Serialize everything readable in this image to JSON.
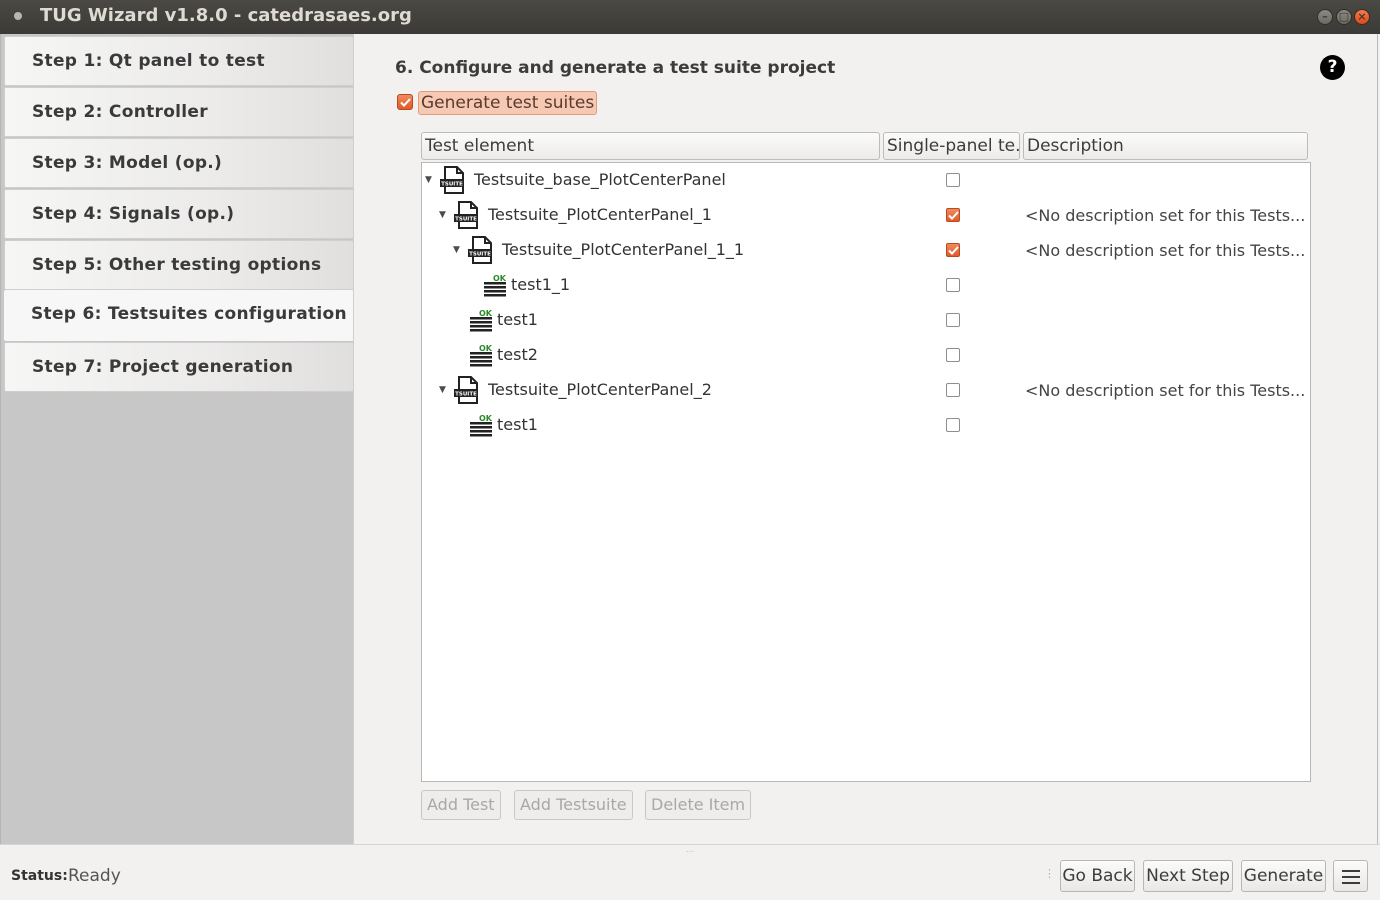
{
  "window": {
    "title": "TUG Wizard v1.8.0 - catedrasaes.org",
    "controls": {
      "minimize": "–",
      "maximize": "□",
      "close": "×"
    }
  },
  "sidebar": {
    "steps": [
      {
        "label": "Step 1: Qt panel to test"
      },
      {
        "label": "Step 2: Controller"
      },
      {
        "label": "Step 3: Model (op.)"
      },
      {
        "label": "Step 4: Signals (op.)"
      },
      {
        "label": "Step 5: Other testing options"
      },
      {
        "label": "Step 6: Testsuites configuration",
        "active": true
      },
      {
        "label": "Step 7: Project generation"
      }
    ]
  },
  "main": {
    "title": "6. Configure and generate a test suite project",
    "help": "?",
    "generate_checkbox": {
      "label": "Generate test suites",
      "checked": true
    },
    "tree": {
      "columns": [
        "Test element",
        "Single-panel te...",
        "Description"
      ],
      "rows": [
        {
          "type": "suite",
          "label": "Testsuite_base_PlotCenterPanel",
          "expanded": true,
          "checked": false,
          "description": ""
        },
        {
          "type": "suite",
          "label": "Testsuite_PlotCenterPanel_1",
          "expanded": true,
          "checked": true,
          "description": "<No description set for this Tests..."
        },
        {
          "type": "suite",
          "label": "Testsuite_PlotCenterPanel_1_1",
          "expanded": true,
          "checked": true,
          "description": "<No description set for this Tests..."
        },
        {
          "type": "test",
          "label": "test1_1",
          "checked": false,
          "description": ""
        },
        {
          "type": "test",
          "label": "test1",
          "checked": false,
          "description": ""
        },
        {
          "type": "test",
          "label": "test2",
          "checked": false,
          "description": ""
        },
        {
          "type": "suite",
          "label": "Testsuite_PlotCenterPanel_2",
          "expanded": true,
          "checked": false,
          "description": "<No description set for this Tests..."
        },
        {
          "type": "test",
          "label": "test1",
          "checked": false,
          "description": ""
        }
      ],
      "suite_icon_text": "TSUITE",
      "test_icon_text": "OK"
    },
    "buttons": {
      "add_test": "Add Test",
      "add_testsuite": "Add Testsuite",
      "delete_item": "Delete Item"
    }
  },
  "statusbar": {
    "label": "Status:",
    "value": "Ready",
    "buttons": {
      "go_back": "Go Back",
      "next_step": "Next Step",
      "generate": "Generate"
    }
  },
  "colors": {
    "accent": "#e05a2b",
    "titlebar": "#3c3b37"
  }
}
